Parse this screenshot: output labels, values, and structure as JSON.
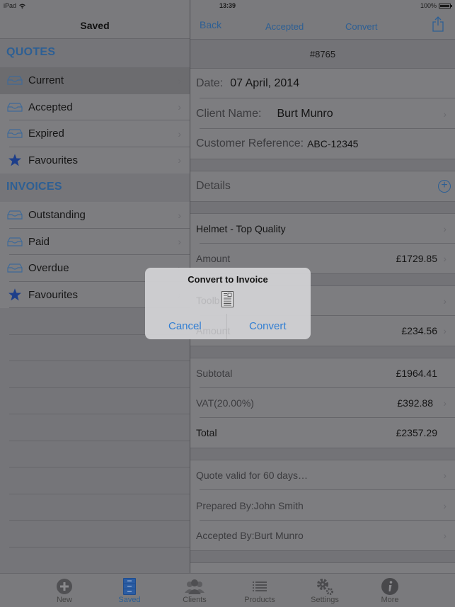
{
  "status_bar": {
    "device": "iPad",
    "time": "13:39",
    "battery": "100%",
    "battery_level": 1.0
  },
  "master": {
    "title": "Saved",
    "sections": [
      {
        "header": "QUOTES",
        "items": [
          {
            "label": "Current",
            "icon": "inbox-icon",
            "selected": true
          },
          {
            "label": "Accepted",
            "icon": "inbox-icon"
          },
          {
            "label": "Expired",
            "icon": "inbox-icon"
          },
          {
            "label": "Favourites",
            "icon": "star-icon"
          }
        ]
      },
      {
        "header": "INVOICES",
        "items": [
          {
            "label": "Outstanding",
            "icon": "inbox-icon"
          },
          {
            "label": "Paid",
            "icon": "inbox-icon"
          },
          {
            "label": "Overdue",
            "icon": "inbox-icon"
          },
          {
            "label": "Favourites",
            "icon": "star-icon"
          }
        ]
      }
    ]
  },
  "detail": {
    "nav": {
      "back": "Back",
      "accepted": "Accepted",
      "convert": "Convert",
      "share_icon": "share-icon"
    },
    "quote_number": "#8765",
    "date_label": "Date:",
    "date_value": "07 April, 2014",
    "client_label": "Client Name:",
    "client_value": "Burt Munro",
    "ref_label": "Customer Reference:",
    "ref_value": "ABC-12345",
    "details_label": "Details",
    "items": [
      {
        "name": "Helmet - Top Quality",
        "amount_label": "Amount",
        "amount": "£1729.85"
      },
      {
        "name": "Toolbox",
        "amount_label": "Amount",
        "amount": "£234.56"
      }
    ],
    "subtotal_label": "Subtotal",
    "subtotal": "£1964.41",
    "vat_label": "VAT(20.00%)",
    "vat": "£392.88",
    "total_label": "Total",
    "total": "£2357.29",
    "notes": [
      "Quote valid for 60 days…",
      "Prepared By:John Smith",
      "Accepted By:Burt Munro"
    ]
  },
  "alert": {
    "title": "Convert to Invoice",
    "cancel": "Cancel",
    "convert": "Convert",
    "behind_text_1": "Toolb",
    "behind_text_2": "Amount"
  },
  "tabbar": {
    "tabs": [
      {
        "label": "New",
        "icon": "plus-circle-icon"
      },
      {
        "label": "Saved",
        "icon": "cabinet-icon",
        "active": true
      },
      {
        "label": "Clients",
        "icon": "people-icon"
      },
      {
        "label": "Products",
        "icon": "list-icon"
      },
      {
        "label": "Settings",
        "icon": "gears-icon"
      },
      {
        "label": "More",
        "icon": "info-icon"
      }
    ]
  },
  "colors": {
    "accent": "#2d5f94",
    "alert_button": "#2f7fd6",
    "overlay_bg": "#757579"
  }
}
